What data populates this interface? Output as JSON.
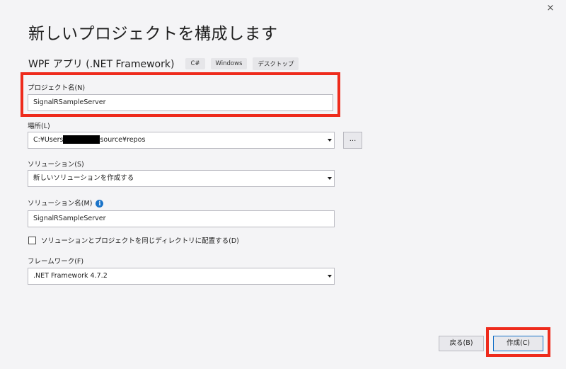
{
  "window": {
    "close_glyph": "×",
    "title": "新しいプロジェクトを構成します"
  },
  "template": {
    "name": "WPF アプリ (.NET Framework)",
    "tags": [
      "C#",
      "Windows",
      "デスクトップ"
    ]
  },
  "project_name": {
    "label": "プロジェクト名(N)",
    "value": "SignalRSampleServer"
  },
  "location": {
    "label": "場所(L)",
    "value_prefix": "C:¥Users",
    "value_suffix": "source¥repos",
    "browse_label": "..."
  },
  "solution": {
    "label": "ソリューション(S)",
    "value": "新しいソリューションを作成する"
  },
  "solution_name": {
    "label": "ソリューション名(M)",
    "info_glyph": "i",
    "value": "SignalRSampleServer"
  },
  "same_directory": {
    "label": "ソリューションとプロジェクトを同じディレクトリに配置する(D)",
    "checked": false
  },
  "framework": {
    "label": "フレームワーク(F)",
    "value": ".NET Framework 4.7.2"
  },
  "buttons": {
    "back_label": "戻る(B)",
    "create_label": "作成(C)"
  },
  "colors": {
    "highlight": "#ee2b1c",
    "accent": "#1a73c8"
  },
  "icons": {
    "close": "close-icon",
    "info": "info-icon",
    "dropdown": "chevron-down-icon"
  }
}
